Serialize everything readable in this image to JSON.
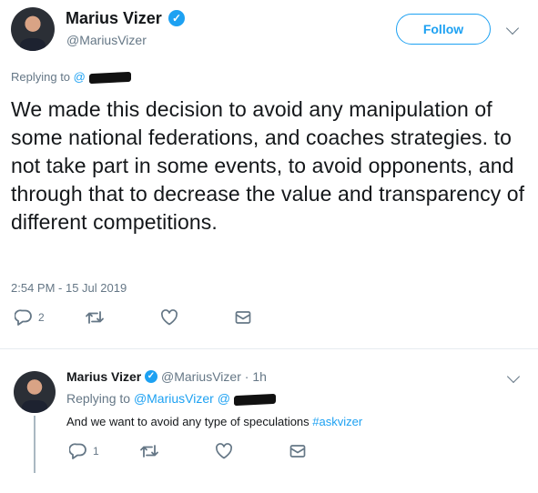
{
  "main_tweet": {
    "author_name": "Marius Vizer",
    "author_handle": "@MariusVizer",
    "follow_label": "Follow",
    "replying_prefix": "Replying to",
    "replying_at": "@",
    "text": "We made this decision to avoid any manipulation of some national federations, and coaches strategies. to not take part in some events, to avoid opponents, and through that to decrease the value and transparency of different competitions.",
    "timestamp": "2:54 PM - 15 Jul 2019",
    "reply_count": "2",
    "icons": [
      "reply-icon",
      "retweet-icon",
      "like-icon",
      "message-icon",
      "verified-badge-icon",
      "chevron-down-icon"
    ]
  },
  "reply_tweet": {
    "author_name": "Marius Vizer",
    "author_handle": "@MariusVizer",
    "separator": "·",
    "time_ago": "1h",
    "replying_prefix": "Replying to",
    "replying_handle": "@MariusVizer",
    "replying_at": "@",
    "text_main": "And we want to avoid any type of speculations",
    "hashtag": "#askvizer",
    "reply_count": "1"
  },
  "colors": {
    "accent": "#1da1f2",
    "text": "#14171a",
    "secondary": "#657786",
    "divider": "#e6ecf0",
    "thread_line": "#aab8c2"
  }
}
